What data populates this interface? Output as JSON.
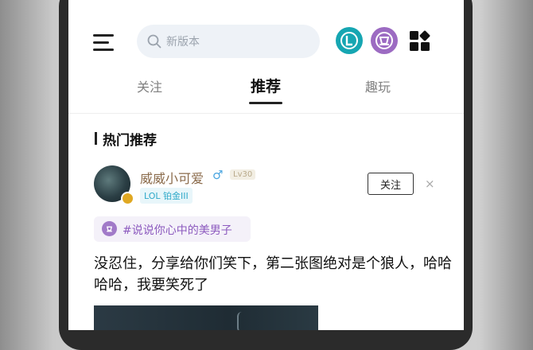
{
  "status_bar": {
    "left": "",
    "center": "",
    "right": ""
  },
  "header": {
    "search_placeholder": "新版本"
  },
  "tabs": [
    {
      "label": "关注",
      "active": false
    },
    {
      "label": "推荐",
      "active": true
    },
    {
      "label": "趣玩",
      "active": false
    }
  ],
  "section": {
    "title": "热门推荐"
  },
  "post": {
    "author": {
      "name": "威威小可爱",
      "gender": "♂",
      "level": "Lv30",
      "rank": "LOL 铂金III"
    },
    "follow_label": "关注",
    "close_label": "×",
    "topic": "#说说你心中的美男子",
    "content": "没忍住，分享给你们笑下，第二张图绝对是个狼人，哈哈哈哈，我要笑死了"
  },
  "colors": {
    "lol_icon": "#16a6b2",
    "tft_icon": "#9c6bc2",
    "topic_text": "#8d5bbf",
    "username": "#8a6a4a"
  },
  "icons": [
    "menu-icon",
    "search-icon",
    "lol-app-icon",
    "tft-app-icon",
    "apps-grid-icon",
    "male-icon",
    "close-icon",
    "topic-icon"
  ]
}
